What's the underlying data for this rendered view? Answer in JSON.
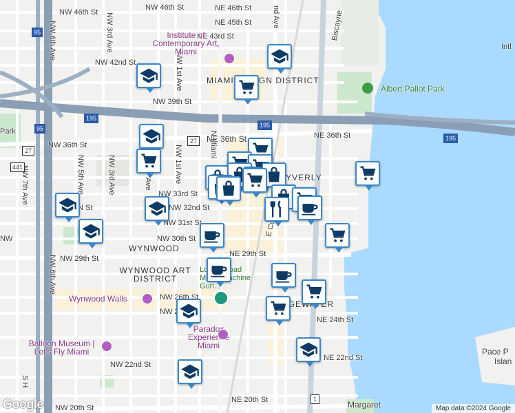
{
  "streets": {
    "nw_46th": "NW 46th St",
    "ne_46th": "NE 46th St",
    "ne_45th": "NE 45th St",
    "ne_43rd": "NE 43rd St",
    "nw_42nd": "NW 42nd St",
    "nw_39th": "NW 39th St",
    "nw_36th": "NW 36th St",
    "ne_36th_a": "NE 36th St",
    "ne_36th_b": "NE 36th St",
    "nw_33rd": "NW 33rd St",
    "nw_32nd": "NW 32nd St",
    "nw_31st": "NW 31st St",
    "nw_30th": "NW 30th St",
    "nw_29th": "NW 29th St",
    "ne_29th": "NE 29th St",
    "nw_26th": "NW 26th St",
    "nw_24th": "NW 24th St",
    "ne_24th": "NE 24th St",
    "ne_22nd": "NE 22nd St",
    "nw_22nd": "NW 22nd St",
    "nw_20th": "NW 20th St",
    "ne_20th": "NE 20th St",
    "nw_6th_ave": "NW 6th Ave",
    "nw_5th_ave": "NW 5th Ave",
    "nw_3rd_ave": "NW 3rd Ave",
    "nw_1st_ave": "NW 1st Ave",
    "nw_7th_ave": "NW 7th Ave",
    "n_miami": "N Miami",
    "ne_2nd_ave": "nd Ave",
    "e_coast": "E Coast",
    "biscayne": "Biscayne",
    "ave_frag": "Ave",
    "n_st": "N St",
    "s_h": "S H",
    "ne_frag": "NE",
    "nw_frag": "NW"
  },
  "areas": {
    "design_district": "MIAMI DESIGN DISTRICT",
    "wynwood": "WYNWOOD",
    "wynwood_art": "WYNWOOD ART DISTRICT",
    "edgewater": "EDGEWATER",
    "bayverly": "BAYVERLY"
  },
  "pois": {
    "ica": "Institute of Contemporary Art, Miami",
    "albert_pallot": "Albert Pallot Park",
    "wynwood_walls": "Wynwood Walls",
    "paradox": "Paradox Experience Miami",
    "balloon": "Balloon Museum | Let's Fly Miami",
    "lock_load": "Lock & Load Miami Machine Gun...",
    "pace": "Pace P",
    "island": "Islan",
    "margaret": "Margaret",
    "intl": "Intl",
    "park": "Park"
  },
  "shields": {
    "i95_a": "95",
    "i95_b": "95",
    "i195": "195",
    "us27": "27",
    "us441": "441",
    "us1": "1",
    "i195_b": "195"
  },
  "map_colors": {
    "water": "#aadaff",
    "road": "#ffffff",
    "highway": "#8a9fb5",
    "park": "#c8e6c9",
    "marker_border": "#3a87c8"
  },
  "footer": {
    "attribution": "Map data ©2024 Google",
    "logo": "Google"
  }
}
